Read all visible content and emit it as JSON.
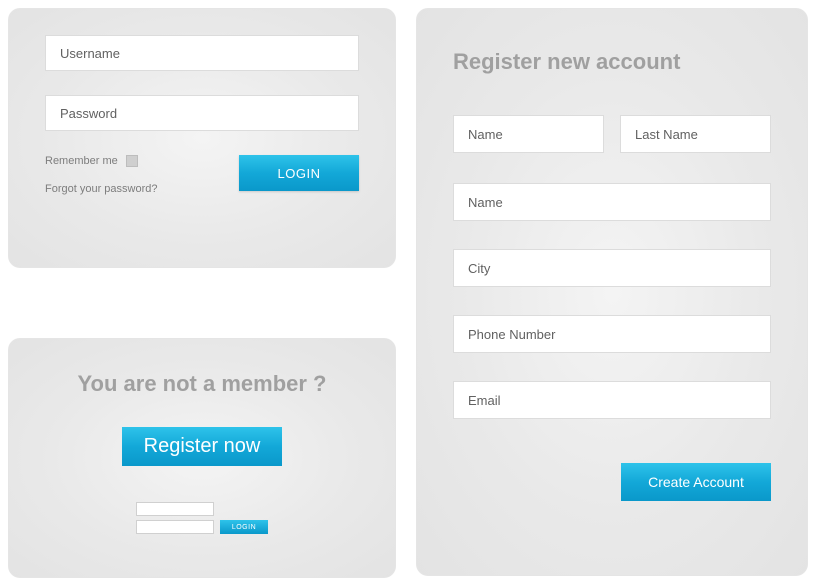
{
  "login": {
    "username_placeholder": "Username",
    "password_placeholder": "Password",
    "remember_label": "Remember me",
    "forgot_label": "Forgot your password?",
    "button_label": "LOGIN"
  },
  "member": {
    "title": "You are not a member ?",
    "register_button": "Register now",
    "mini_login_button": "LOGIN"
  },
  "register": {
    "title": "Register new account",
    "first_name_placeholder": "Name",
    "last_name_placeholder": "Last Name",
    "name2_placeholder": "Name",
    "city_placeholder": "City",
    "phone_placeholder": "Phone Number",
    "email_placeholder": "Email",
    "create_button": "Create Account"
  }
}
